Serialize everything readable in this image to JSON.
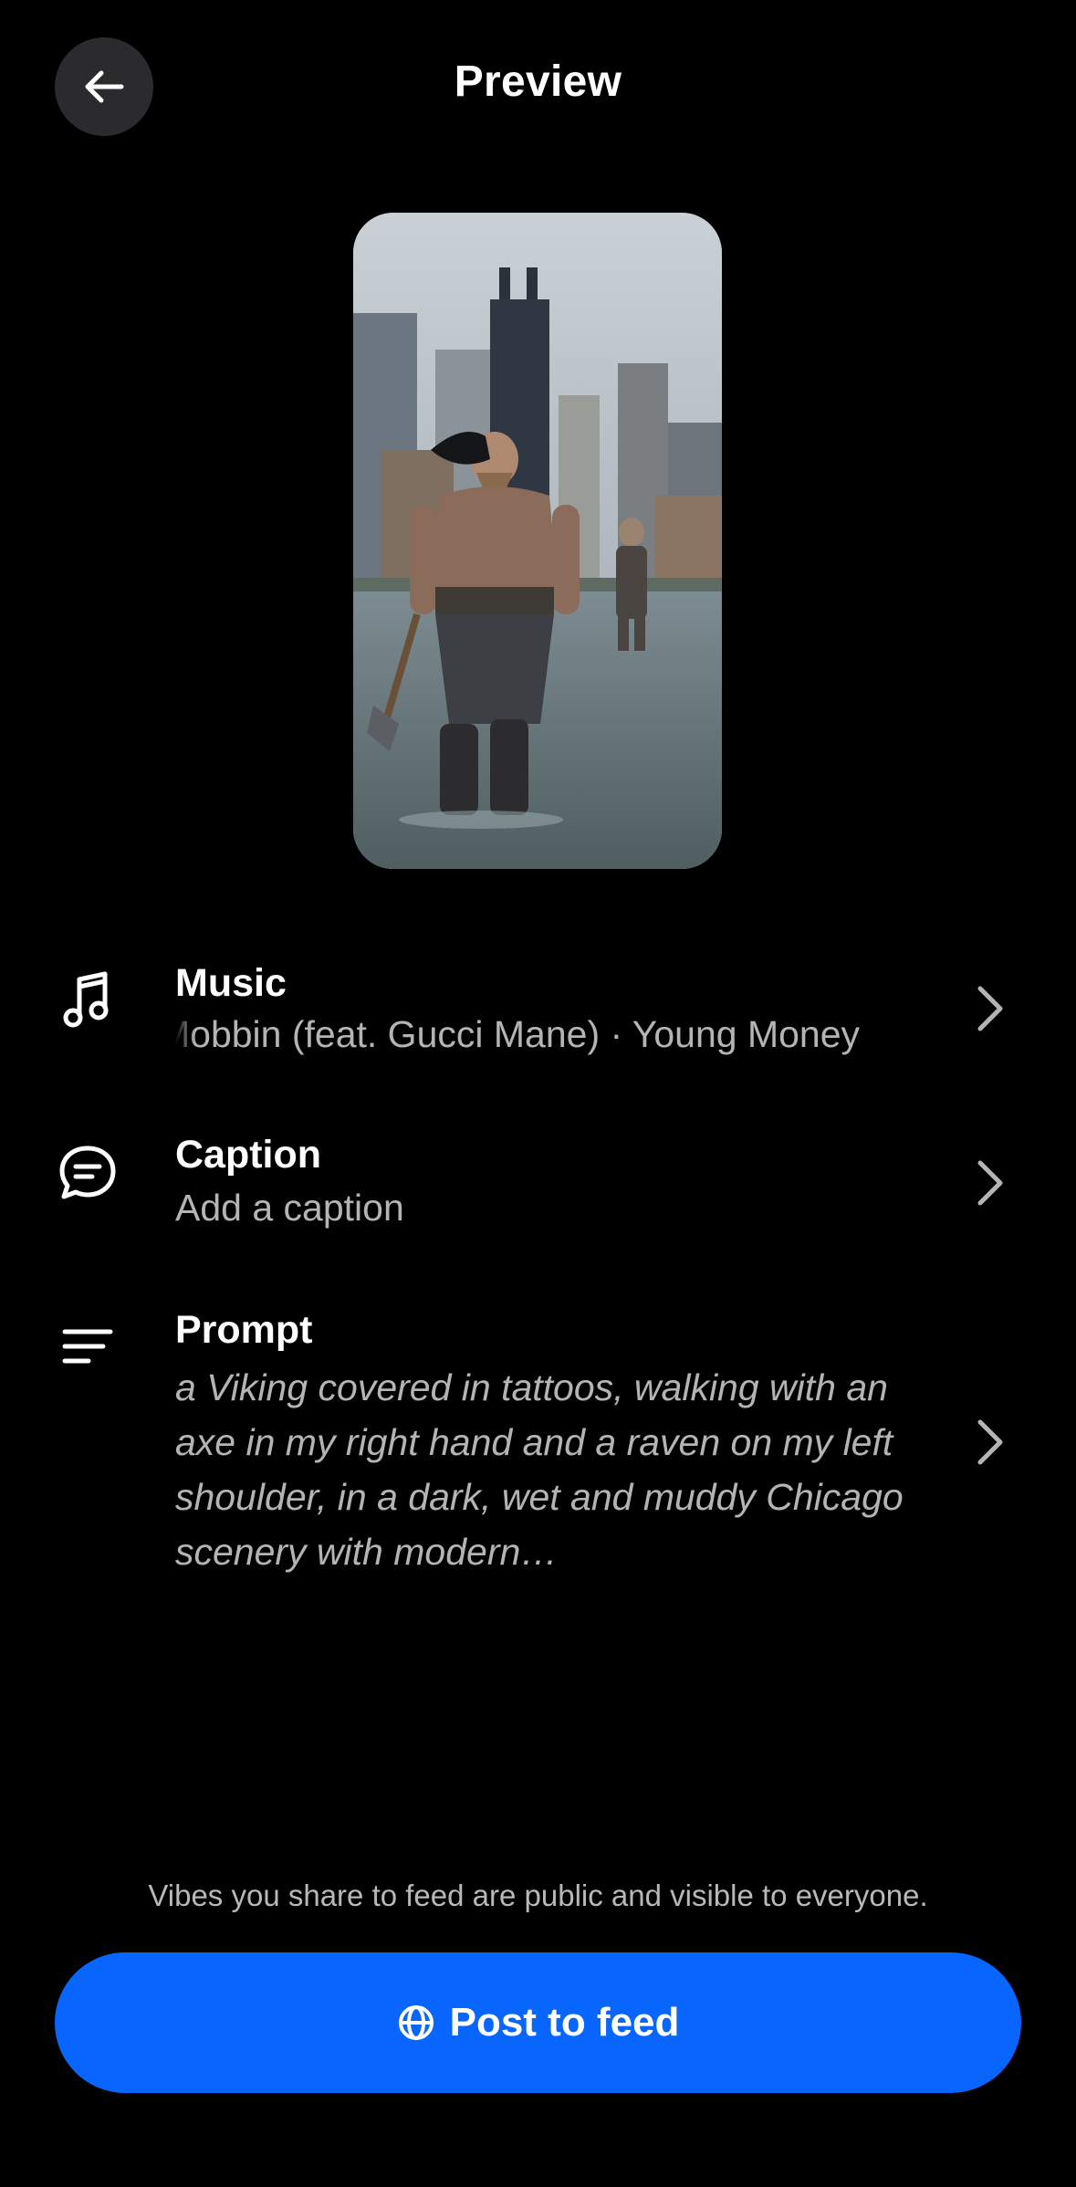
{
  "header": {
    "title": "Preview",
    "back_icon": "arrow-left-icon"
  },
  "preview": {
    "subject": "viking-chicago-video-thumbnail"
  },
  "settings": {
    "music": {
      "title": "Music",
      "value": "Mobbin (feat. Gucci Mane) · Young Money",
      "icon": "music-note-icon"
    },
    "caption": {
      "title": "Caption",
      "placeholder": "Add a caption",
      "icon": "speech-bubble-icon"
    },
    "prompt": {
      "title": "Prompt",
      "value": "a Viking covered in tattoos, walking with an axe in my right hand and a raven on my left shoulder, in a dark, wet and muddy Chicago scenery with modern…",
      "icon": "text-lines-icon"
    }
  },
  "footer": {
    "disclaimer": "Vibes you share to feed are public and visible to everyone.",
    "post_label": "Post to feed",
    "post_icon": "globe-icon"
  },
  "colors": {
    "background": "#000000",
    "accent": "#0866ff",
    "secondary_text": "#b4b4b4",
    "back_button_bg": "#2b2b2d"
  }
}
